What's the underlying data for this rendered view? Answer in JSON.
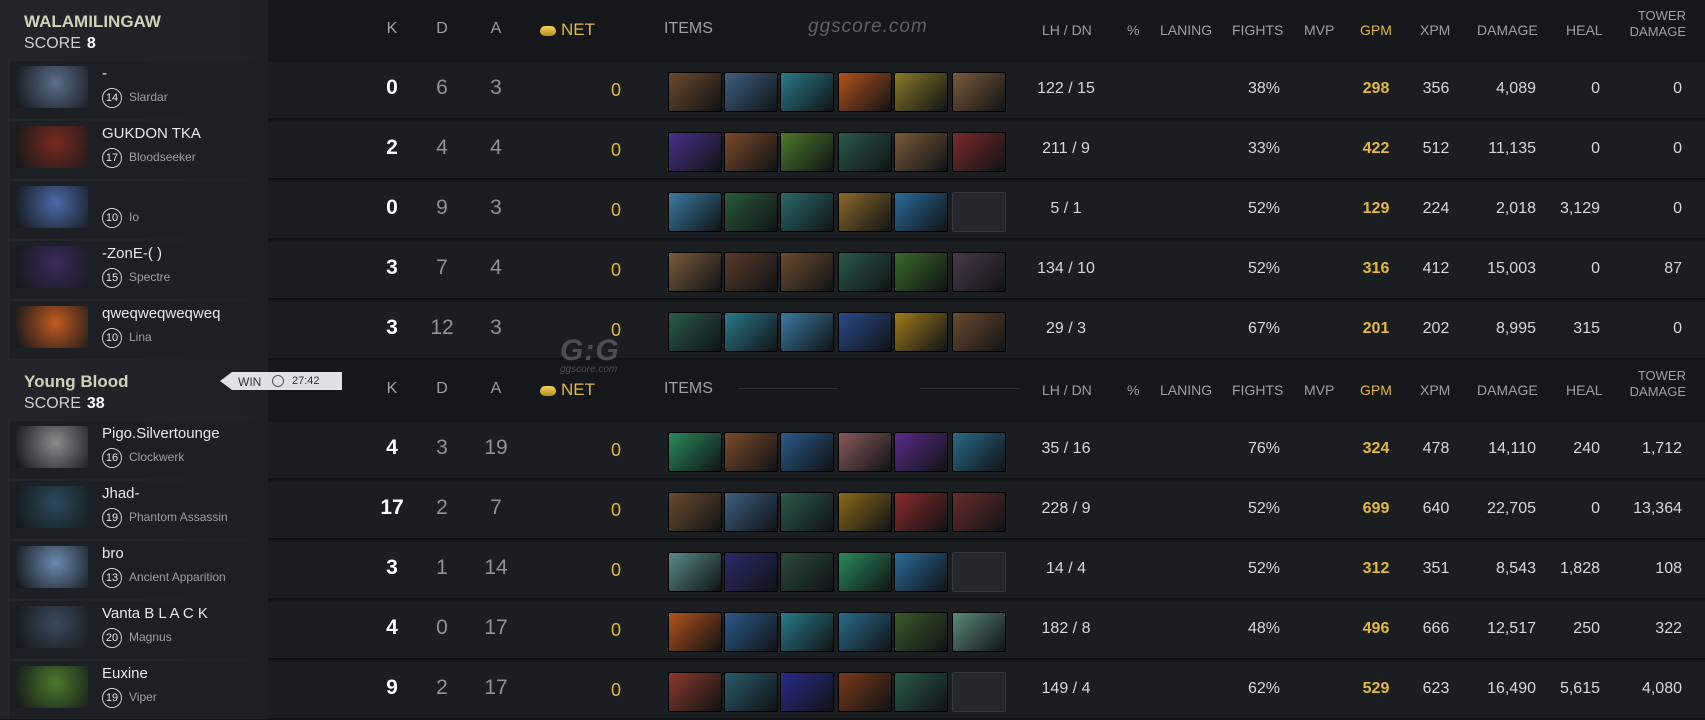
{
  "watermark": "ggscore.com",
  "logo": {
    "big": "G:G",
    "small": "ggscore.com"
  },
  "headers": {
    "k": "K",
    "d": "D",
    "a": "A",
    "net": "NET",
    "items": "ITEMS",
    "lhdn": "LH / DN",
    "pct": "%",
    "laning": "LANING",
    "fights": "FIGHTS",
    "mvp": "MVP",
    "gpm": "GPM",
    "xpm": "XPM",
    "damage": "DAMAGE",
    "heal": "HEAL",
    "tower1": "TOWER",
    "tower2": "DAMAGE"
  },
  "result": {
    "label": "WIN",
    "time": "27:42"
  },
  "teams": [
    {
      "name": "WALAMILINGAW",
      "score_label": "SCORE",
      "score": "8",
      "players": [
        {
          "name": "-",
          "level": "14",
          "hero": "Slardar",
          "k": "0",
          "d": "6",
          "a": "3",
          "net": "0",
          "lhdn": "122  /  15",
          "fights": "38%",
          "gpm": "298",
          "xpm": "356",
          "damage": "4,089",
          "heal": "0",
          "tower": "0",
          "portrait": "#5b6d8a",
          "items": [
            "#6b4a2e",
            "#3d5f80",
            "#2a7a8a",
            "#b3521c",
            "#8a7a2a",
            "#7a5a3a"
          ]
        },
        {
          "name": "GUKDON TKA",
          "level": "17",
          "hero": "Bloodseeker",
          "k": "2",
          "d": "4",
          "a": "4",
          "net": "0",
          "lhdn": "211  /  9",
          "fights": "33%",
          "gpm": "422",
          "xpm": "512",
          "damage": "11,135",
          "heal": "0",
          "tower": "0",
          "portrait": "#7a2a1f",
          "items": [
            "#4b2f8a",
            "#7a4a2a",
            "#4a7a2a",
            "#2a5a4a",
            "#7a5a3a",
            "#7a2a2a"
          ]
        },
        {
          "name": "",
          "level": "10",
          "hero": "Io",
          "k": "0",
          "d": "9",
          "a": "3",
          "net": "0",
          "lhdn": "5  /  1",
          "fights": "52%",
          "gpm": "129",
          "xpm": "224",
          "damage": "2,018",
          "heal": "3,129",
          "tower": "0",
          "portrait": "#4a6aa8",
          "items": [
            "#3a7aa0",
            "#2a5a3a",
            "#2a6a6a",
            "#8a6a2a",
            "#2a6a9a",
            "empty"
          ]
        },
        {
          "name": "-ZonE-(    )",
          "level": "15",
          "hero": "Spectre",
          "k": "3",
          "d": "7",
          "a": "4",
          "net": "0",
          "lhdn": "134  /  10",
          "fights": "52%",
          "gpm": "316",
          "xpm": "412",
          "damage": "15,003",
          "heal": "0",
          "tower": "87",
          "portrait": "#3a2a5a",
          "items": [
            "#7a5a3a",
            "#5a3a2a",
            "#6b4a2e",
            "#2a5a4a",
            "#3a6a2a",
            "#4a3a4a"
          ]
        },
        {
          "name": "qweqweqweqweq",
          "level": "10",
          "hero": "Lina",
          "k": "3",
          "d": "12",
          "a": "3",
          "net": "0",
          "lhdn": "29  /  3",
          "fights": "67%",
          "gpm": "201",
          "xpm": "202",
          "damage": "8,995",
          "heal": "315",
          "tower": "0",
          "portrait": "#c25a1f",
          "items": [
            "#2a5a4a",
            "#2a7a8a",
            "#3a7aa0",
            "#2a4a8a",
            "#a07a1a",
            "#6b4a2e"
          ]
        }
      ]
    },
    {
      "name": "Young Blood",
      "score_label": "SCORE",
      "score": "38",
      "players": [
        {
          "name": "Pigo.Silvertounge",
          "level": "16",
          "hero": "Clockwerk",
          "k": "4",
          "d": "3",
          "a": "19",
          "net": "0",
          "lhdn": "35  /  16",
          "fights": "76%",
          "gpm": "324",
          "xpm": "478",
          "damage": "14,110",
          "heal": "240",
          "tower": "1,712",
          "portrait": "#8a8a8a",
          "items": [
            "#2a8a5a",
            "#7a4a2a",
            "#2a5a8a",
            "#8a5a5a",
            "#5a2a8a",
            "#2a6a8a"
          ]
        },
        {
          "name": "Jhad-",
          "level": "19",
          "hero": "Phantom Assassin",
          "k": "17",
          "d": "2",
          "a": "7",
          "net": "0",
          "lhdn": "228  /  9",
          "fights": "52%",
          "gpm": "699",
          "xpm": "640",
          "damage": "22,705",
          "heal": "0",
          "tower": "13,364",
          "portrait": "#2a4a5a",
          "items": [
            "#6b4a2e",
            "#3d5f80",
            "#2a5a4a",
            "#8a6a1a",
            "#8a2a2a",
            "#6a2a2a"
          ]
        },
        {
          "name": "bro",
          "level": "13",
          "hero": "Ancient Apparition",
          "k": "3",
          "d": "1",
          "a": "14",
          "net": "0",
          "lhdn": "14  /  4",
          "fights": "52%",
          "gpm": "312",
          "xpm": "351",
          "damage": "8,543",
          "heal": "1,828",
          "tower": "108",
          "portrait": "#6a8ab0",
          "items": [
            "#5a8a8a",
            "#2a2a6a",
            "#2a4a3a",
            "#2a8a5a",
            "#2a6a9a",
            "empty"
          ]
        },
        {
          "name": "Vanta B L A C K",
          "level": "20",
          "hero": "Magnus",
          "k": "4",
          "d": "0",
          "a": "17",
          "net": "0",
          "lhdn": "182  /  8",
          "fights": "48%",
          "gpm": "496",
          "xpm": "666",
          "damage": "12,517",
          "heal": "250",
          "tower": "322",
          "portrait": "#3a4a5a",
          "items": [
            "#b3521c",
            "#2a5a8a",
            "#2a7a8a",
            "#2a6a8a",
            "#3a5a2a",
            "#5a8a7a"
          ]
        },
        {
          "name": "Euxine",
          "level": "19",
          "hero": "Viper",
          "k": "9",
          "d": "2",
          "a": "17",
          "net": "0",
          "lhdn": "149  /  4",
          "fights": "62%",
          "gpm": "529",
          "xpm": "623",
          "damage": "16,490",
          "heal": "5,615",
          "tower": "4,080",
          "portrait": "#4a7a2a",
          "items": [
            "#8a3a2a",
            "#2a5a6a",
            "#2a2a8a",
            "#7a3a1a",
            "#2a5a4a",
            "empty"
          ]
        }
      ]
    }
  ]
}
